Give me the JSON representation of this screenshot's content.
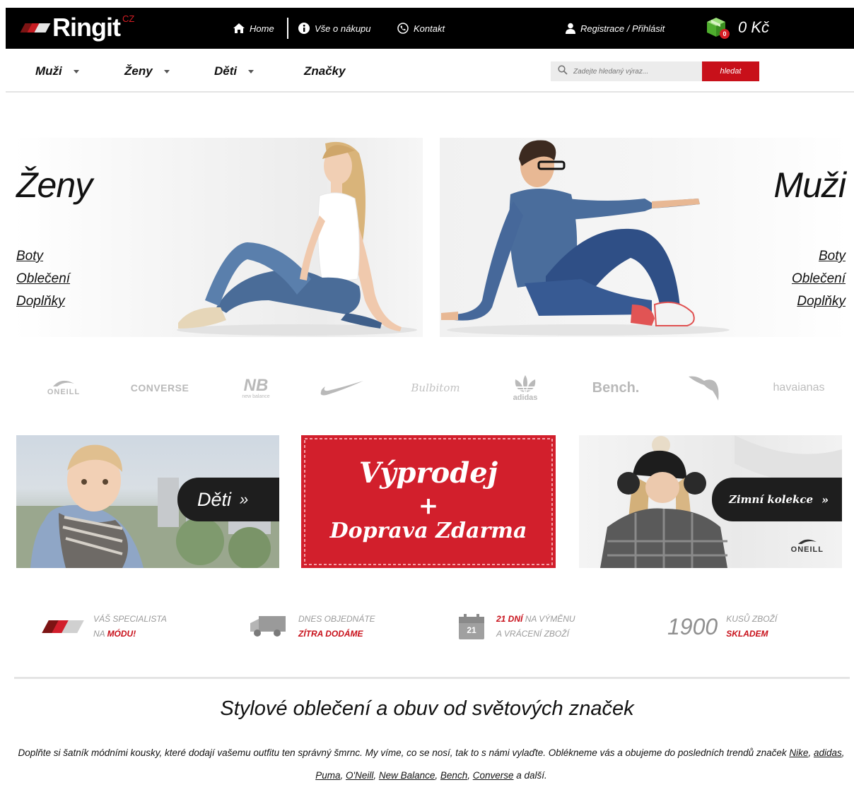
{
  "header": {
    "logo_text": "Ringit",
    "logo_suffix": "CZ",
    "nav": {
      "home": "Home",
      "about": "Vše o nákupu",
      "contact": "Kontakt",
      "account": "Registrace / Přihlásit"
    },
    "cart": {
      "total": "0 Kč",
      "count": "0"
    },
    "colors": {
      "brand_red": "#c8101a",
      "bar": "#000000"
    }
  },
  "categories": [
    {
      "label": "Muži",
      "dropdown": true
    },
    {
      "label": "Ženy",
      "dropdown": true
    },
    {
      "label": "Děti",
      "dropdown": true
    },
    {
      "label": "Značky",
      "dropdown": false
    }
  ],
  "search": {
    "placeholder": "Zadejte hledaný výraz...",
    "button": "hledat"
  },
  "hero": {
    "women": {
      "title": "Ženy",
      "links": [
        "Boty",
        "Oblečení",
        "Doplňky"
      ]
    },
    "men": {
      "title": "Muži",
      "links": [
        "Boty",
        "Oblečení",
        "Doplňky"
      ]
    }
  },
  "brands": [
    {
      "name": "O'Neill",
      "label": "ONEILL",
      "icon": "oneill-wave-icon"
    },
    {
      "name": "Converse",
      "label": "CONVERSE",
      "icon": ""
    },
    {
      "name": "New Balance",
      "label": "new balance",
      "icon": "nb-icon"
    },
    {
      "name": "Nike",
      "label": "",
      "icon": "nike-swoosh-icon"
    },
    {
      "name": "Bulbitom",
      "label": "Bulbitom",
      "icon": ""
    },
    {
      "name": "adidas",
      "label": "adidas",
      "icon": "adidas-trefoil-icon"
    },
    {
      "name": "Bench",
      "label": "Bench.",
      "icon": ""
    },
    {
      "name": "Puma",
      "label": "",
      "icon": "puma-cat-icon"
    },
    {
      "name": "Havaianas",
      "label": "havaianas",
      "icon": ""
    }
  ],
  "promos": {
    "kids": {
      "label": "Děti",
      "chevron": "»"
    },
    "sale": {
      "line1": "Výprodej",
      "plus": "+",
      "line2": "Doprava Zdarma"
    },
    "winter": {
      "label": "Zimní kolekce",
      "chevron": "»",
      "brand": "ONEILL"
    }
  },
  "features": [
    {
      "line1": "Váš specialista",
      "line2_plain": "na ",
      "line2_red": "módu!",
      "icon": "ringit-mark-icon"
    },
    {
      "line1": "Dnes objednáte",
      "line2_plain": "",
      "line2_red": "zítra dodáme",
      "icon": "truck-icon"
    },
    {
      "line1_red": "21 dní",
      "line1": " na výměnu",
      "line2_plain": "a vrácení zboží",
      "icon": "calendar-icon",
      "calendar_day": "21"
    },
    {
      "number": "1900",
      "line1": "kusů zboží",
      "line2_red": "skladem"
    }
  ],
  "about": {
    "title": "Stylové oblečení a obuv od světových značek",
    "text_start": "Doplňte si šatník módními kousky, které dodají vašemu outfitu ten správný šmrnc. My víme, co se nosí, tak to s námi vylaďte. Oblékneme vás a obujeme do posledních trendů značek ",
    "brand_links": [
      "Nike",
      "adidas",
      "Puma",
      "O'Neill",
      "New Balance",
      "Bench",
      "Converse"
    ],
    "text_end": " a další."
  }
}
